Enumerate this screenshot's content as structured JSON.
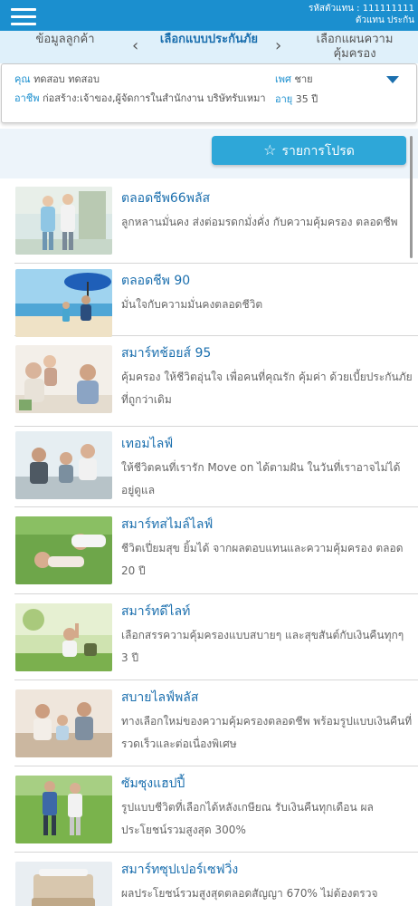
{
  "header": {
    "agent_code": "รหัสตัวแทน : 111111111",
    "agent_role": "ตัวแทน ประกัน"
  },
  "steps": {
    "prev": "ข้อมูลลูกค้า",
    "current": "เลือกแบบประกันภัย",
    "next": "เลือกแผนความคุ้มครอง"
  },
  "customer": {
    "name_label": "คุณ",
    "name": "ทดสอบ ทดสอบ",
    "occupation_label": "อาชีพ",
    "occupation": "ก่อสร้าง:เจ้าของ,ผู้จัดการในสำนักงาน บริษัทรับเหมา",
    "sex_label": "เพศ",
    "sex": "ชาย",
    "age_label": "อายุ",
    "age": "35 ปี"
  },
  "favorites_button": "รายการโปรด",
  "plans": [
    {
      "title": "ตลอดชีพ66พลัส",
      "desc": "ลูกหลานมั่นคง ส่งต่อมรดกมั่งคั่ง กับความคุ้มครอง ตลอดชีพ"
    },
    {
      "title": "ตลอดชีพ 90",
      "desc": "มั่นใจกับความมั่นคงตลอดชีวิต"
    },
    {
      "title": "สมาร์ทช้อยส์ 95",
      "desc": "คุ้มครอง ให้ชีวิตอุ่นใจ เพื่อคนที่คุณรัก คุ้มค่า ด้วยเบี้ยประกันภัยที่ถูกว่าเดิม"
    },
    {
      "title": "เทอมไลฟ์",
      "desc": "ให้ชีวิตคนที่เรารัก Move on ได้ตามฝัน ในวันที่เราอาจไม่ได้อยู่ดูแล"
    },
    {
      "title": "สมาร์ทสไมล์ไลฟ์",
      "desc": "ชีวิตเปี่ยมสุข ยิ้มได้ จากผลตอบแทนและความคุ้มครอง ตลอด 20 ปี"
    },
    {
      "title": "สมาร์ทดีไลท์",
      "desc": "เลือกสรรความคุ้มครองแบบสบายๆ และสุขสันต์กับเงินคืนทุกๆ 3 ปี"
    },
    {
      "title": "สบายไลฟ์พลัส",
      "desc": "ทางเลือกใหม่ของความคุ้มครองตลอดชีพ พร้อมรูปแบบเงินคืนที่รวดเร็วและต่อเนื่องพิเศษ"
    },
    {
      "title": "ซัมซุงแฮปปี้",
      "desc": "รูปแบบชีวิตที่เลือกได้หลังเกษียณ รับเงินคืนทุกเดือน ผลประโยชน์รวมสูงสุด 300%"
    },
    {
      "title": "สมาร์ทซุปเปอร์เซฟวิ่ง",
      "desc": "ผลประโยชน์รวมสูงสุดตลอดสัญญา 670% ไม่ต้องตรวจ"
    }
  ],
  "icons": {
    "menu": "hamburger-menu-icon",
    "prev": "chevron-left-icon",
    "next": "chevron-right-icon",
    "toggle": "caret-down-icon",
    "favorite": "star-outline-icon"
  },
  "colors": {
    "topbar": "#1b8fcf",
    "step_bar": "#dff0fa",
    "accent_text": "#1b6fae",
    "favorite_button": "#2ea7d8"
  }
}
